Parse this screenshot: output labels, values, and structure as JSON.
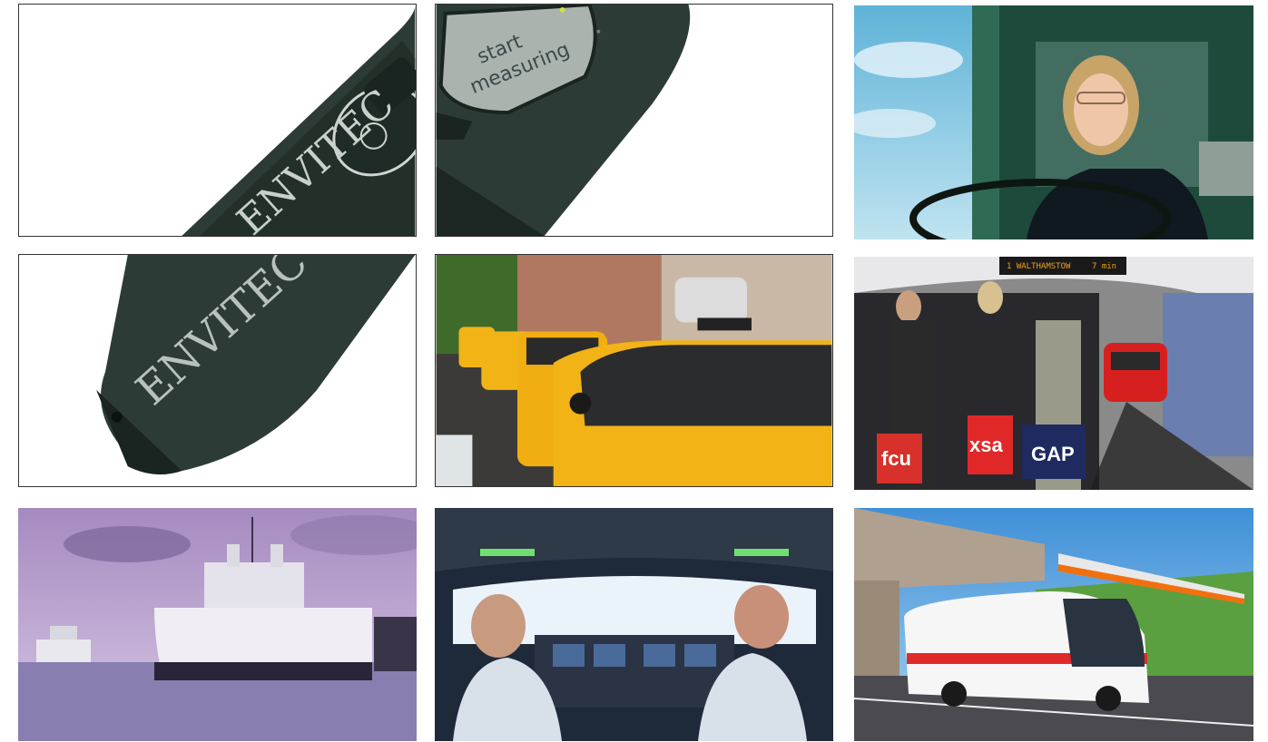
{
  "tiles": [
    {
      "id": "device-closeup-buttons",
      "brand_text": "ENVITEC"
    },
    {
      "id": "device-lcd-screen",
      "lcd": {
        "line1": "start",
        "line2": "measuring"
      }
    },
    {
      "id": "bus-driver"
    },
    {
      "id": "device-tip",
      "brand_text": "ENVITEC"
    },
    {
      "id": "taxi-queue"
    },
    {
      "id": "subway-platform",
      "bags": [
        "fcu",
        "xsa",
        "GAP"
      ],
      "sign": "1 WALTHAMSTOW",
      "sign_time": "7 min"
    },
    {
      "id": "ferry-ships"
    },
    {
      "id": "aircraft-cockpit"
    },
    {
      "id": "coach-bus-and-train"
    }
  ],
  "colors": {
    "device_body": "#2d3b36",
    "taxi_yellow": "#f2b316",
    "sky_purple": "#b99ad0",
    "train_red": "#d62020",
    "bus_stripe": "#e02a2a"
  }
}
